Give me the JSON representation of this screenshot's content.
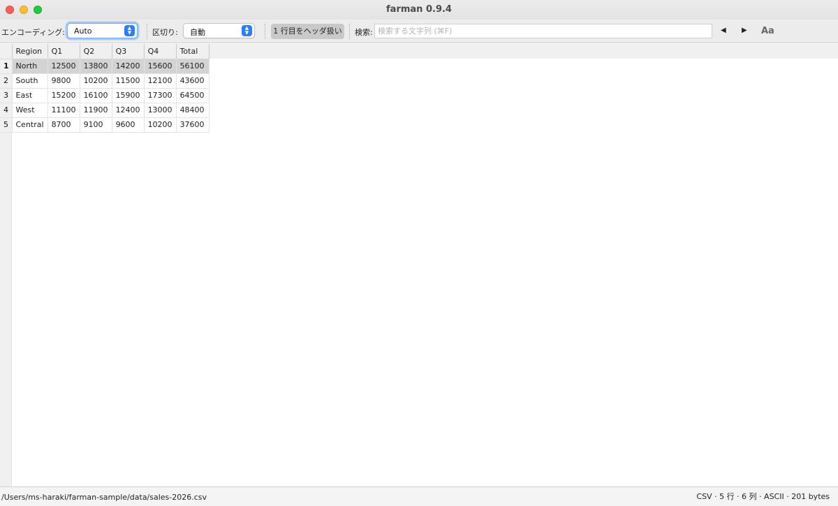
{
  "window": {
    "title": "farman 0.9.4"
  },
  "toolbar": {
    "encoding_label": "エンコーディング:",
    "encoding_value": "Auto",
    "delimiter_label": "区切り:",
    "delimiter_value": "自動",
    "header_button": "1 行目をヘッダ扱い",
    "search_label": "検索:",
    "search_placeholder": "検索する文字列 (⌘F)",
    "search_value": "",
    "prev_glyph": "◀",
    "next_glyph": "▶",
    "case_toggle": "Aa",
    "accent_color": "#2e7cf6"
  },
  "table": {
    "columns": [
      "Region",
      "Q1",
      "Q2",
      "Q3",
      "Q4",
      "Total"
    ],
    "row_numbers": [
      "1",
      "2",
      "3",
      "4",
      "5"
    ],
    "selected_row": 1,
    "rows": [
      [
        "North",
        "12500",
        "13800",
        "14200",
        "15600",
        "56100"
      ],
      [
        "South",
        "9800",
        "10200",
        "11500",
        "12100",
        "43600"
      ],
      [
        "East",
        "15200",
        "16100",
        "15900",
        "17300",
        "64500"
      ],
      [
        "West",
        "11100",
        "11900",
        "12400",
        "13000",
        "48400"
      ],
      [
        "Central",
        "8700",
        "9100",
        "9600",
        "10200",
        "37600"
      ]
    ]
  },
  "status": {
    "path": "/Users/ms-haraki/farman-sample/data/sales-2026.csv",
    "info": "CSV · 5 行 · 6 列 · ASCII · 201 bytes"
  }
}
